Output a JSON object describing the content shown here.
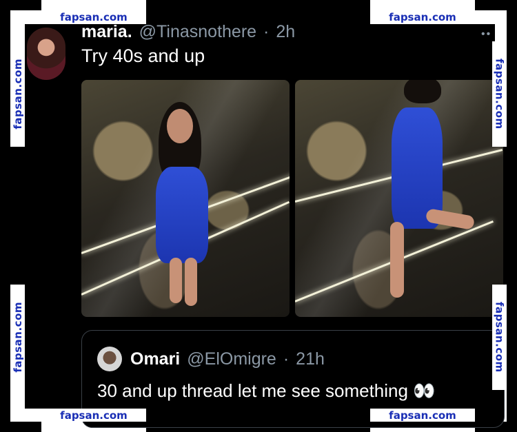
{
  "watermark": {
    "text": "fapsan.com"
  },
  "tweet": {
    "author_name": "maria.",
    "author_handle": "@Tinasnothere",
    "separator": "·",
    "time": "2h",
    "more": "••",
    "text": "Try 40s and up",
    "media_count": 2
  },
  "quoted_tweet": {
    "author_name": "Omari",
    "author_handle": "@ElOmigre",
    "separator": "·",
    "time": "21h",
    "text": "30 and up thread let me see something 👀"
  },
  "colors": {
    "background": "#000000",
    "text": "#ffffff",
    "muted": "#8b98a5",
    "watermark": "#1a2fb5",
    "dress": "#2f4fd6"
  }
}
